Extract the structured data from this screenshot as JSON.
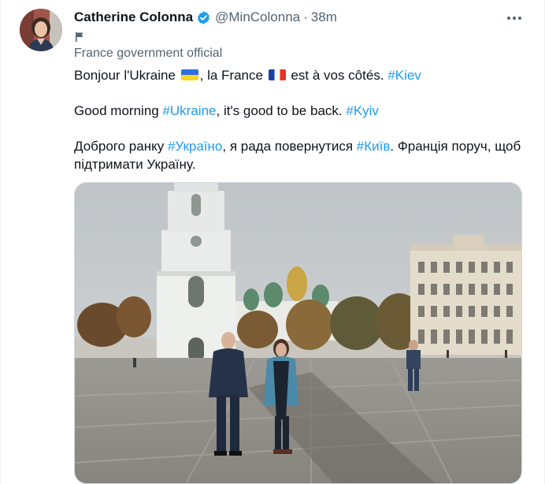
{
  "tweet": {
    "author_name": "Catherine Colonna",
    "handle": "@MinColonna",
    "separator": "·",
    "time": "38m",
    "account_label": "France government official",
    "line1": {
      "before_flag1": "Bonjour l'Ukraine ",
      "between_flags": ", la France ",
      "after_flag2": " est à vos côtés. ",
      "hashtag": "#Kiev"
    },
    "line2": {
      "before": "Good morning ",
      "hashtag1": "#Ukraine",
      "middle": ", it's good to be back. ",
      "hashtag2": "#Kyiv"
    },
    "line3": {
      "before": "Доброго ранку ",
      "hashtag1": "#Україно",
      "middle": ", я рада повернутися ",
      "hashtag2": "#Київ",
      "after": ". Франція поруч, щоб"
    },
    "line4": "підтримати Україну."
  },
  "colors": {
    "text": "#0f1419",
    "secondary": "#536471",
    "link": "#1d9bf0",
    "verified": "#1d9bf0",
    "border": "#cfd9de"
  },
  "icons": {
    "verified": "verified-badge-icon",
    "more": "more-options-icon",
    "label": "government-flag-icon",
    "flag_ukraine": "flag-ukraine-icon",
    "flag_france": "flag-france-icon"
  }
}
